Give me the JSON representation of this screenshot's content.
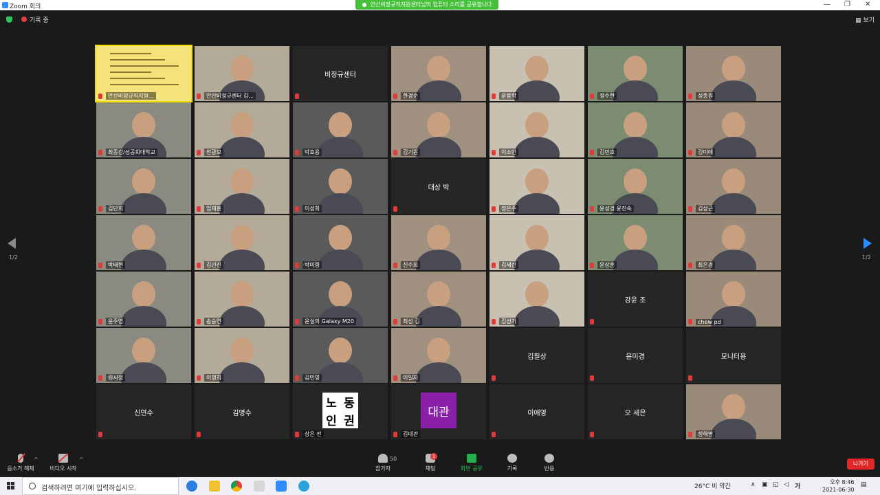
{
  "window": {
    "title": "Zoom 회의",
    "minimize": "—",
    "maximize": "❐",
    "close": "✕"
  },
  "banner": {
    "text": "안산비정규직지원센터님의 컴퓨터 소리를 공유합니다"
  },
  "topbar": {
    "recording": "기록 중",
    "view": "보기"
  },
  "nav": {
    "page_left": "1/2",
    "page_right": "1/2"
  },
  "tiles": [
    {
      "name": "안산비정규직지원...",
      "video": true,
      "active": true
    },
    {
      "name": "안산비정규센터 김...",
      "video": true
    },
    {
      "name": "",
      "center": "비정규센터"
    },
    {
      "name": "한경순",
      "video": true
    },
    {
      "name": "윤봉학",
      "video": true
    },
    {
      "name": "정수현",
      "video": true
    },
    {
      "name": "성종원",
      "video": true
    },
    {
      "name": "최종강/성공회대학교",
      "video": true
    },
    {
      "name": "천광모",
      "video": true
    },
    {
      "name": "박호용",
      "video": true
    },
    {
      "name": "김기원",
      "video": true
    },
    {
      "name": "이소민",
      "video": true
    },
    {
      "name": "김민호",
      "video": true
    },
    {
      "name": "김미애",
      "video": true
    },
    {
      "name": "김단희",
      "video": true
    },
    {
      "name": "엄재홍",
      "video": true
    },
    {
      "name": "이성희",
      "video": true
    },
    {
      "name": "",
      "center": "대상 박"
    },
    {
      "name": "정은주",
      "video": true
    },
    {
      "name": "윤성경 윤진숙",
      "video": true
    },
    {
      "name": "김상근",
      "video": true
    },
    {
      "name": "박태현",
      "video": true
    },
    {
      "name": "김민진",
      "video": true
    },
    {
      "name": "박미령",
      "video": true
    },
    {
      "name": "신수희",
      "video": true
    },
    {
      "name": "김세린",
      "video": true
    },
    {
      "name": "윤상훈",
      "video": true
    },
    {
      "name": "최은경",
      "video": true
    },
    {
      "name": "윤주영",
      "video": true
    },
    {
      "name": "송승연",
      "video": true
    },
    {
      "name": "윤실의 Galaxy M20",
      "video": true
    },
    {
      "name": "최성 김",
      "video": true
    },
    {
      "name": "김성기",
      "video": true
    },
    {
      "name": "",
      "center": "강윤 조"
    },
    {
      "name": "chew pd",
      "video": true
    },
    {
      "name": "원서정",
      "video": true
    },
    {
      "name": "이명희",
      "video": true
    },
    {
      "name": "김민영",
      "video": true
    },
    {
      "name": "이일자",
      "video": true
    },
    {
      "name": "",
      "center": "김필상"
    },
    {
      "name": "",
      "center": "윤미경"
    },
    {
      "name": "",
      "center": "모니터용"
    },
    {
      "name": "",
      "center": "신연수"
    },
    {
      "name": "",
      "center": "김명수"
    },
    {
      "name": "상은 전",
      "logo": "노동인권"
    },
    {
      "name": "김대관",
      "logo2": "대관"
    },
    {
      "name": "",
      "center": "이애영"
    },
    {
      "name": "",
      "center": "오 세은"
    },
    {
      "name": "정해명",
      "video": true
    }
  ],
  "logos": {
    "labor": [
      "노",
      "동",
      "인",
      "권"
    ],
    "daegwan": "대관"
  },
  "toolbar": {
    "unmute": "음소거 해제",
    "start_video": "비디오 시작",
    "participants": "참가자",
    "participants_count": "50",
    "chat": "채팅",
    "chat_badge": "1",
    "share": "화면 공유",
    "record": "기록",
    "reactions": "반응",
    "leave": "나가기"
  },
  "taskbar": {
    "search_placeholder": "검색하려면 여기에 입력하십시오.",
    "weather": "26°C  비 약간",
    "ime": "가",
    "time": "오후 8:46",
    "date": "2021-06-30"
  }
}
